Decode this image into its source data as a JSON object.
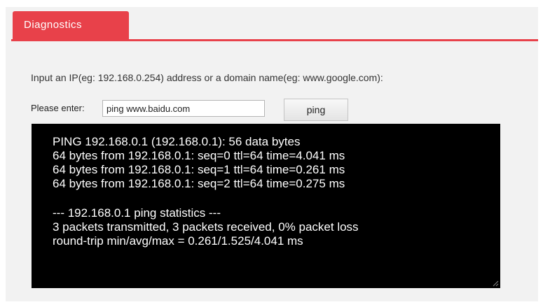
{
  "tab": {
    "label": "Diagnostics"
  },
  "form": {
    "instruction": "Input an IP(eg: 192.168.0.254) address or a domain name(eg: www.google.com):",
    "enter_label": "Please enter:",
    "input_value": "ping www.baidu.com",
    "button_label": "ping"
  },
  "output": {
    "lines_top": [
      "PING 192.168.0.1 (192.168.0.1): 56 data bytes",
      "64 bytes from 192.168.0.1: seq=0 ttl=64 time=4.041 ms",
      "64 bytes from 192.168.0.1: seq=1 ttl=64 time=0.261 ms",
      "64 bytes from 192.168.0.1: seq=2 ttl=64 time=0.275 ms"
    ],
    "lines_bottom": [
      "--- 192.168.0.1 ping statistics ---",
      "3 packets transmitted, 3 packets received, 0% packet loss",
      "round-trip min/avg/max = 0.261/1.525/4.041 ms"
    ]
  },
  "colors": {
    "accent": "#e8414a",
    "console_bg": "#000000",
    "console_text": "#ffffff",
    "panel_bg": "#f2f2f2"
  }
}
